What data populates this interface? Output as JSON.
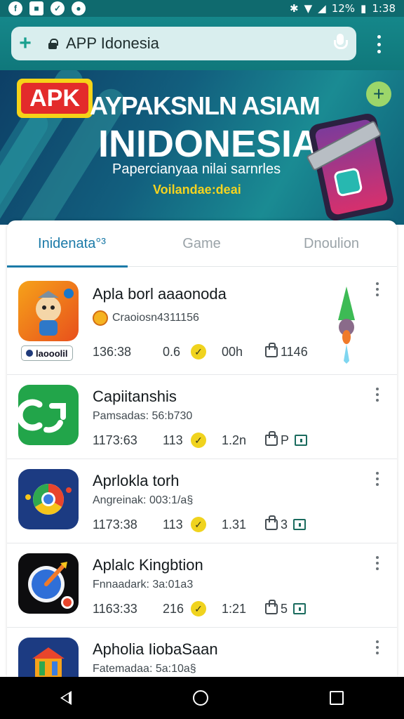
{
  "status_bar": {
    "battery": "12%",
    "time": "1:38"
  },
  "browser": {
    "url_text": "APP Idonesia"
  },
  "banner": {
    "badge": "APK",
    "title_line1": "AYPAKSNLN ASIAM",
    "title_line2": "INIDONESIA",
    "subtitle": "Papercianyaa nilai sarnrles",
    "tagline": "Voilandae:deai"
  },
  "tabs": [
    {
      "label": "Inidenata°³"
    },
    {
      "label": "Game"
    },
    {
      "label": "Dnoulion"
    }
  ],
  "apps": [
    {
      "name": "Apla borl aaaonoda",
      "subtitle": "Craoiosn4311156",
      "stat1": "136:38",
      "stat2": "0.6",
      "stat3": "00h",
      "like_text": "1146",
      "publisher": "laooolil"
    },
    {
      "name": "Capiitanshis",
      "subtitle": "Pamsadas: 56:b730",
      "stat1": "1173:63",
      "stat2": "113",
      "stat3": "1.2n",
      "like_text": "P"
    },
    {
      "name": "Aprlokla torh",
      "subtitle": "Angreinak: 003:1/a§",
      "stat1": "1173:38",
      "stat2": "113",
      "stat3": "1.31",
      "like_text": "3"
    },
    {
      "name": "Aplalc Kingbtion",
      "subtitle": "Fnnaadark: 3a:01a3",
      "stat1": "1163:33",
      "stat2": "216",
      "stat3": "1:21",
      "like_text": "5"
    },
    {
      "name": "Apholia IiobaSaan",
      "subtitle": "Fatemadaa: 5a:10a§"
    }
  ],
  "colors": {
    "accent": "#1b7aa8",
    "header_teal": "#10787b",
    "check_yellow": "#f0d31e"
  }
}
